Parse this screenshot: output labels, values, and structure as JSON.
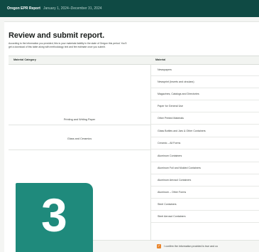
{
  "header": {
    "app_title": "Oregon EPR Report",
    "period": "January 1, 2024–December 31, 2024"
  },
  "page": {
    "title": "Review and submit report.",
    "description_line1": "According to the information you provided, this is your materials liability in the state of Oregon this period. You'll",
    "description_line2": "get a download of this table along with methodology text and fee estimate once you submit."
  },
  "table": {
    "columns": [
      "Material Category",
      "Material"
    ],
    "groups": [
      {
        "category": "Printing and Writing Paper",
        "materials": [
          "Newspapers",
          "Newsprint (Inserts and circulars)",
          "Magazines, Catalogs and Directories",
          "Paper for General Use",
          "Other Printed Materials"
        ]
      },
      {
        "category": "Glass and Ceramics",
        "materials": [
          "Glass Bottles and Jars & Other Containers",
          "Ceramic – All Forms"
        ]
      },
      {
        "category": "",
        "materials": [
          "Aluminum Containers",
          "Aluminum Foil and Molded Containers",
          "Aluminum Aerosol Containers",
          "Aluminum – Other Forms",
          "Steel Containers",
          "Steel Aerosol Containers"
        ]
      }
    ]
  },
  "badge": {
    "step": "3"
  },
  "footer": {
    "confirm_text": "I confirm the information provided is true and co",
    "checked": true
  },
  "colors": {
    "topbar": "#0f4a44",
    "badge": "#1f8a7c",
    "checkbox": "#e9852b"
  }
}
